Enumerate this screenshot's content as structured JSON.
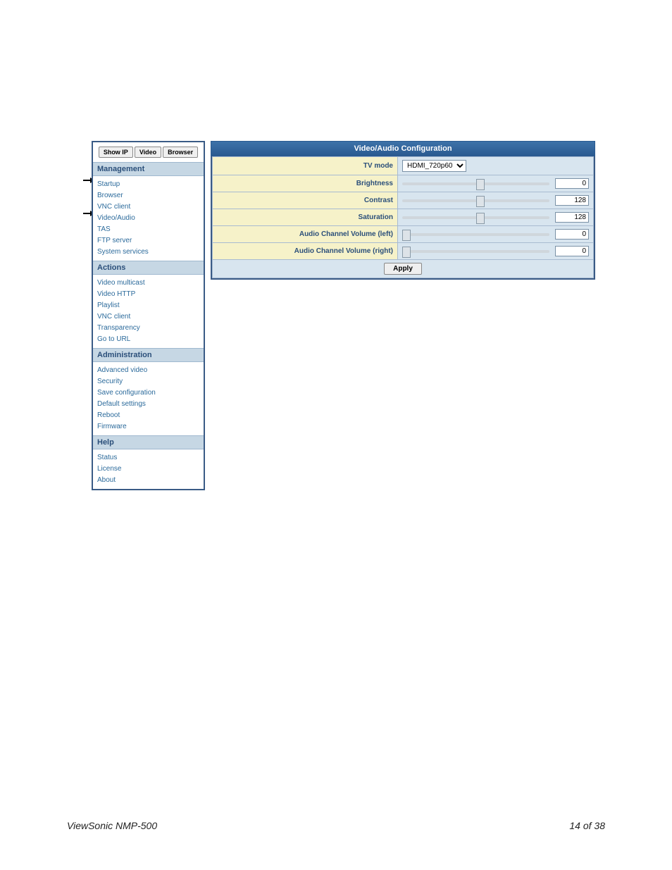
{
  "sidebar": {
    "buttons": {
      "showip": "Show IP",
      "video": "Video",
      "browser": "Browser"
    },
    "sections": [
      {
        "title": "Management",
        "items": [
          "Startup",
          "Browser",
          "VNC client",
          "Video/Audio",
          "TAS",
          "FTP server",
          "System services"
        ]
      },
      {
        "title": "Actions",
        "items": [
          "Video multicast",
          "Video HTTP",
          "Playlist",
          "VNC client",
          "Transparency",
          "Go to URL"
        ]
      },
      {
        "title": "Administration",
        "items": [
          "Advanced video",
          "Security",
          "Save configuration",
          "Default settings",
          "Reboot",
          "Firmware"
        ]
      },
      {
        "title": "Help",
        "items": [
          "Status",
          "License",
          "About"
        ]
      }
    ]
  },
  "panel": {
    "title": "Video/Audio Configuration",
    "rows": {
      "tvmode": {
        "label": "TV mode",
        "value": "HDMI_720p60"
      },
      "brightness": {
        "label": "Brightness",
        "value": "0",
        "pos": 50
      },
      "contrast": {
        "label": "Contrast",
        "value": "128",
        "pos": 50
      },
      "saturation": {
        "label": "Saturation",
        "value": "128",
        "pos": 50
      },
      "avl": {
        "label": "Audio Channel Volume (left)",
        "value": "0",
        "pos": 0
      },
      "avr": {
        "label": "Audio Channel Volume (right)",
        "value": "0",
        "pos": 0
      }
    },
    "apply": "Apply"
  },
  "footer": {
    "left": "ViewSonic NMP-500",
    "right": "14 of  38"
  }
}
